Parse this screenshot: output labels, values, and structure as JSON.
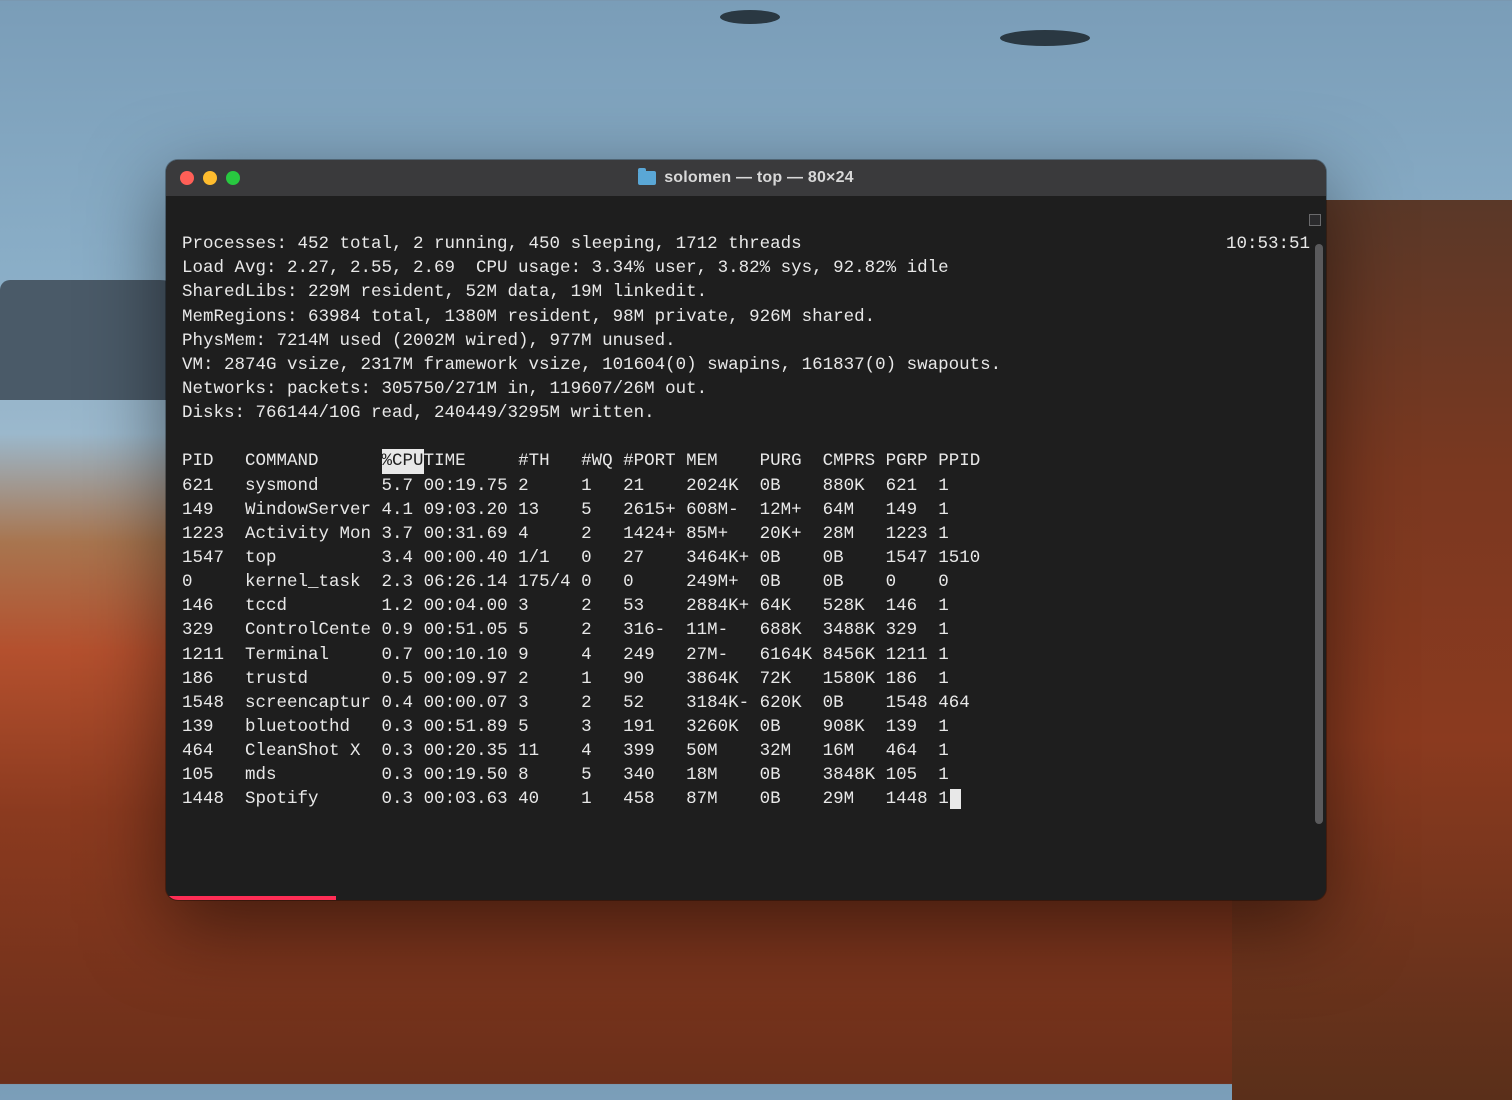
{
  "window": {
    "title": "solomen — top — 80×24"
  },
  "clock": "10:53:51",
  "summary": {
    "processes": "Processes: 452 total, 2 running, 450 sleeping, 1712 threads",
    "load": "Load Avg: 2.27, 2.55, 2.69  CPU usage: 3.34% user, 3.82% sys, 92.82% idle",
    "sharedlibs": "SharedLibs: 229M resident, 52M data, 19M linkedit.",
    "memregions": "MemRegions: 63984 total, 1380M resident, 98M private, 926M shared.",
    "physmem": "PhysMem: 7214M used (2002M wired), 977M unused.",
    "vm": "VM: 2874G vsize, 2317M framework vsize, 101604(0) swapins, 161837(0) swapouts.",
    "networks": "Networks: packets: 305750/271M in, 119607/26M out.",
    "disks": "Disks: 766144/10G read, 240449/3295M written."
  },
  "columns": [
    "PID",
    "COMMAND",
    "%CPU",
    "TIME",
    "#TH",
    "#WQ",
    "#PORT",
    "MEM",
    "PURG",
    "CMPRS",
    "PGRP",
    "PPID"
  ],
  "sorted_column": "%CPU",
  "rows": [
    {
      "pid": "621",
      "command": "sysmond",
      "cpu": "5.7",
      "time": "00:19.75",
      "th": "2",
      "wq": "1",
      "port": "21",
      "mem": "2024K",
      "purg": "0B",
      "cmprs": "880K",
      "pgrp": "621",
      "ppid": "1"
    },
    {
      "pid": "149",
      "command": "WindowServer",
      "cpu": "4.1",
      "time": "09:03.20",
      "th": "13",
      "wq": "5",
      "port": "2615+",
      "mem": "608M-",
      "purg": "12M+",
      "cmprs": "64M",
      "pgrp": "149",
      "ppid": "1"
    },
    {
      "pid": "1223",
      "command": "Activity Mon",
      "cpu": "3.7",
      "time": "00:31.69",
      "th": "4",
      "wq": "2",
      "port": "1424+",
      "mem": "85M+",
      "purg": "20K+",
      "cmprs": "28M",
      "pgrp": "1223",
      "ppid": "1"
    },
    {
      "pid": "1547",
      "command": "top",
      "cpu": "3.4",
      "time": "00:00.40",
      "th": "1/1",
      "wq": "0",
      "port": "27",
      "mem": "3464K+",
      "purg": "0B",
      "cmprs": "0B",
      "pgrp": "1547",
      "ppid": "1510"
    },
    {
      "pid": "0",
      "command": "kernel_task",
      "cpu": "2.3",
      "time": "06:26.14",
      "th": "175/4",
      "wq": "0",
      "port": "0",
      "mem": "249M+",
      "purg": "0B",
      "cmprs": "0B",
      "pgrp": "0",
      "ppid": "0"
    },
    {
      "pid": "146",
      "command": "tccd",
      "cpu": "1.2",
      "time": "00:04.00",
      "th": "3",
      "wq": "2",
      "port": "53",
      "mem": "2884K+",
      "purg": "64K",
      "cmprs": "528K",
      "pgrp": "146",
      "ppid": "1"
    },
    {
      "pid": "329",
      "command": "ControlCente",
      "cpu": "0.9",
      "time": "00:51.05",
      "th": "5",
      "wq": "2",
      "port": "316-",
      "mem": "11M-",
      "purg": "688K",
      "cmprs": "3488K",
      "pgrp": "329",
      "ppid": "1"
    },
    {
      "pid": "1211",
      "command": "Terminal",
      "cpu": "0.7",
      "time": "00:10.10",
      "th": "9",
      "wq": "4",
      "port": "249",
      "mem": "27M-",
      "purg": "6164K",
      "cmprs": "8456K",
      "pgrp": "1211",
      "ppid": "1"
    },
    {
      "pid": "186",
      "command": "trustd",
      "cpu": "0.5",
      "time": "00:09.97",
      "th": "2",
      "wq": "1",
      "port": "90",
      "mem": "3864K",
      "purg": "72K",
      "cmprs": "1580K",
      "pgrp": "186",
      "ppid": "1"
    },
    {
      "pid": "1548",
      "command": "screencaptur",
      "cpu": "0.4",
      "time": "00:00.07",
      "th": "3",
      "wq": "2",
      "port": "52",
      "mem": "3184K-",
      "purg": "620K",
      "cmprs": "0B",
      "pgrp": "1548",
      "ppid": "464"
    },
    {
      "pid": "139",
      "command": "bluetoothd",
      "cpu": "0.3",
      "time": "00:51.89",
      "th": "5",
      "wq": "3",
      "port": "191",
      "mem": "3260K",
      "purg": "0B",
      "cmprs": "908K",
      "pgrp": "139",
      "ppid": "1"
    },
    {
      "pid": "464",
      "command": "CleanShot X",
      "cpu": "0.3",
      "time": "00:20.35",
      "th": "11",
      "wq": "4",
      "port": "399",
      "mem": "50M",
      "purg": "32M",
      "cmprs": "16M",
      "pgrp": "464",
      "ppid": "1"
    },
    {
      "pid": "105",
      "command": "mds",
      "cpu": "0.3",
      "time": "00:19.50",
      "th": "8",
      "wq": "5",
      "port": "340",
      "mem": "18M",
      "purg": "0B",
      "cmprs": "3848K",
      "pgrp": "105",
      "ppid": "1"
    },
    {
      "pid": "1448",
      "command": "Spotify",
      "cpu": "0.3",
      "time": "00:03.63",
      "th": "40",
      "wq": "1",
      "port": "458",
      "mem": "87M",
      "purg": "0B",
      "cmprs": "29M",
      "pgrp": "1448",
      "ppid": "1"
    }
  ]
}
